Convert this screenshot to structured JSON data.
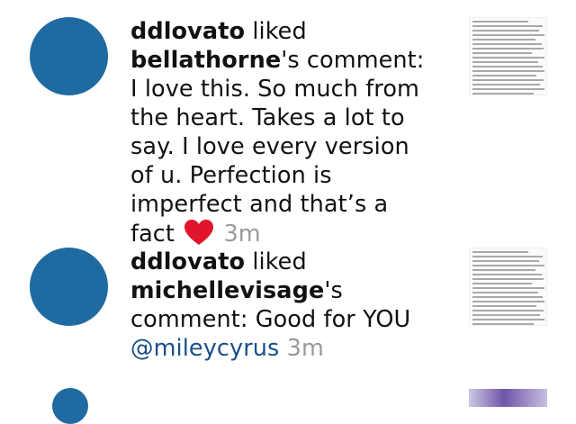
{
  "colors": {
    "avatar": "#1f6aa0",
    "mention": "#1a4f8a",
    "timestamp": "#9a9a9a",
    "heart": "#e0142a",
    "partial_thumb": "#6d55a8"
  },
  "notifications": [
    {
      "actor": "ddlovato",
      "action": "liked",
      "target_user": "bellathorne",
      "comment_prefix": "'s comment: I love this. So much from the heart. Takes a lot to say. I love every version of u. Perfection is imperfect and that’s a fact",
      "emoji": "red-heart",
      "time": "3m"
    },
    {
      "actor": "ddlovato",
      "action": "liked",
      "target_user": "michellevisage",
      "comment_prefix": "'s comment: Good for YOU",
      "mention": "@mileycyrus",
      "time": "3m"
    }
  ]
}
